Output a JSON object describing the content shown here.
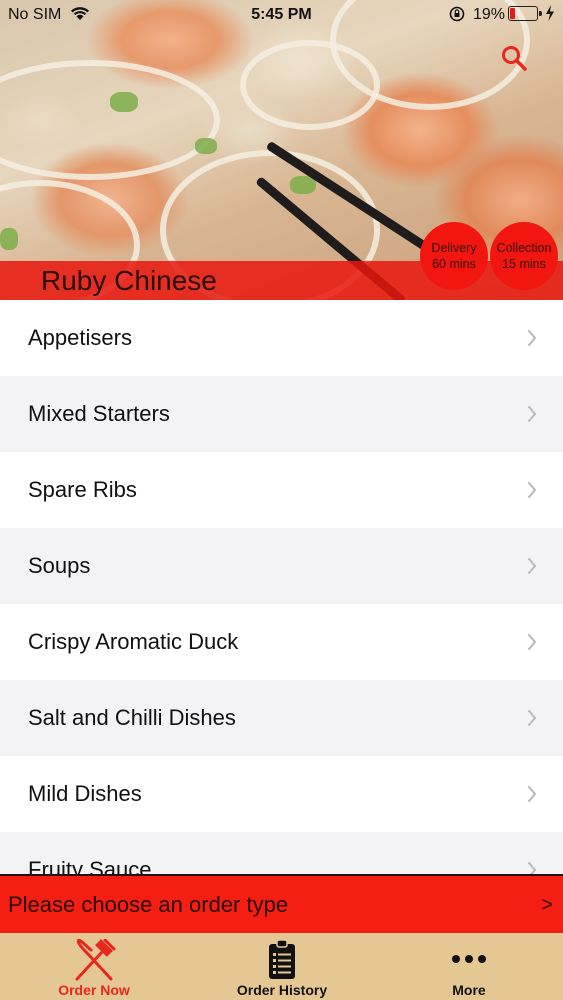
{
  "status_bar": {
    "carrier": "No SIM",
    "time": "5:45 PM",
    "battery_percent": "19%",
    "battery_level": 0.19
  },
  "header": {
    "restaurant_name": "Ruby Chinese",
    "search_icon": "search-icon",
    "delivery": {
      "label": "Delivery",
      "time": "60 mins"
    },
    "collection": {
      "label": "Collection",
      "time": "15 mins"
    }
  },
  "menu": {
    "categories": [
      "Appetisers",
      "Mixed Starters",
      "Spare Ribs",
      "Soups",
      "Crispy Aromatic Duck",
      "Salt and Chilli Dishes",
      "Mild Dishes",
      "Fruity Sauce"
    ]
  },
  "order_bar": {
    "text": "Please choose an order type",
    "arrow": ">"
  },
  "tab_bar": {
    "tabs": [
      {
        "label": "Order Now",
        "icon": "fork-knife-icon",
        "active": true
      },
      {
        "label": "Order History",
        "icon": "clipboard-list-icon",
        "active": false
      },
      {
        "label": "More",
        "icon": "more-dots-icon",
        "active": false
      }
    ]
  },
  "colors": {
    "accent_red": "#f41f12",
    "tab_bar_bg": "#e5c794",
    "active_tab": "#e8261b"
  }
}
